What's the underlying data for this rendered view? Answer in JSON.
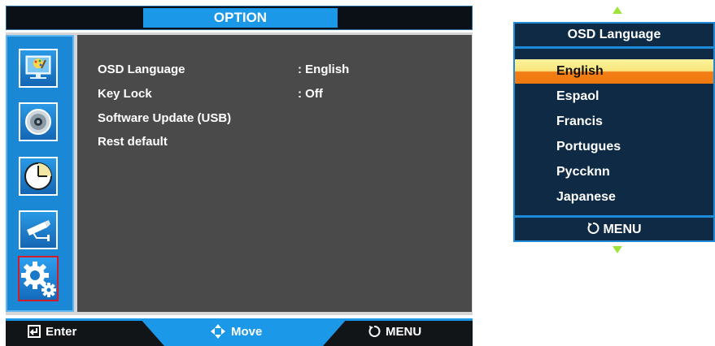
{
  "title": "OPTION",
  "sidebar": {
    "items": [
      {
        "icon": "picture-icon"
      },
      {
        "icon": "sound-icon"
      },
      {
        "icon": "clock-icon"
      },
      {
        "icon": "camera-icon"
      },
      {
        "icon": "settings-gears-icon",
        "selected": true
      }
    ]
  },
  "menu": {
    "items": [
      {
        "label": "OSD Language",
        "value": ": English"
      },
      {
        "label": "Key Lock",
        "value": ": Off"
      },
      {
        "label": "Software Update (USB)",
        "value": ""
      },
      {
        "label": "Rest default",
        "value": ""
      }
    ]
  },
  "footer": {
    "enter_label": "Enter",
    "move_label": "Move",
    "menu_label": "MENU"
  },
  "language_popup": {
    "title": "OSD Language",
    "options": [
      "English",
      "Espaol",
      "Francis",
      "Portugues",
      "Pyccknn",
      "Japanese"
    ],
    "selected": "English",
    "menu_label": "MENU"
  },
  "colors": {
    "accent_blue": "#1c98e8",
    "highlight_yellow": "#f8e47c",
    "highlight_orange": "#f07a10",
    "popup_bg": "#0e2a44",
    "content_bg": "#4a4a4a",
    "selected_border": "#d21c2a",
    "arrow_green": "#9fe23a"
  }
}
